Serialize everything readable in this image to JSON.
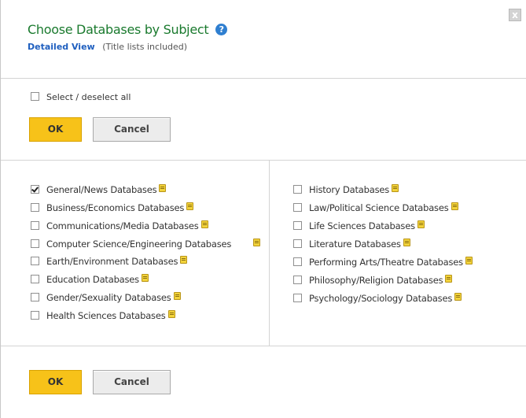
{
  "dialog": {
    "title": "Choose Databases by Subject",
    "help_icon": "question-circle-icon",
    "detailed_view_link": "Detailed View",
    "detailed_view_note": "(Title lists included)",
    "close_glyph": "x"
  },
  "select_all": {
    "label": "Select / deselect all",
    "checked": false
  },
  "buttons": {
    "ok_label": "OK",
    "cancel_label": "Cancel"
  },
  "colors": {
    "title": "#1a7a2e",
    "link": "#1f5fbf",
    "ok_button": "#f7c219",
    "note_icon": "#f2d33b"
  },
  "databases_left": [
    {
      "label": "General/News Databases",
      "checked": true
    },
    {
      "label": "Business/Economics Databases",
      "checked": false
    },
    {
      "label": "Communications/Media Databases",
      "checked": false
    },
    {
      "label": "Computer Science/Engineering Databases",
      "checked": false
    },
    {
      "label": "Earth/Environment Databases",
      "checked": false
    },
    {
      "label": "Education Databases",
      "checked": false
    },
    {
      "label": "Gender/Sexuality Databases",
      "checked": false
    },
    {
      "label": "Health Sciences Databases",
      "checked": false
    }
  ],
  "databases_right": [
    {
      "label": "History Databases",
      "checked": false
    },
    {
      "label": "Law/Political Science Databases",
      "checked": false
    },
    {
      "label": "Life Sciences Databases",
      "checked": false
    },
    {
      "label": "Literature Databases",
      "checked": false
    },
    {
      "label": "Performing Arts/Theatre Databases",
      "checked": false
    },
    {
      "label": "Philosophy/Religion Databases",
      "checked": false
    },
    {
      "label": "Psychology/Sociology Databases",
      "checked": false
    }
  ]
}
